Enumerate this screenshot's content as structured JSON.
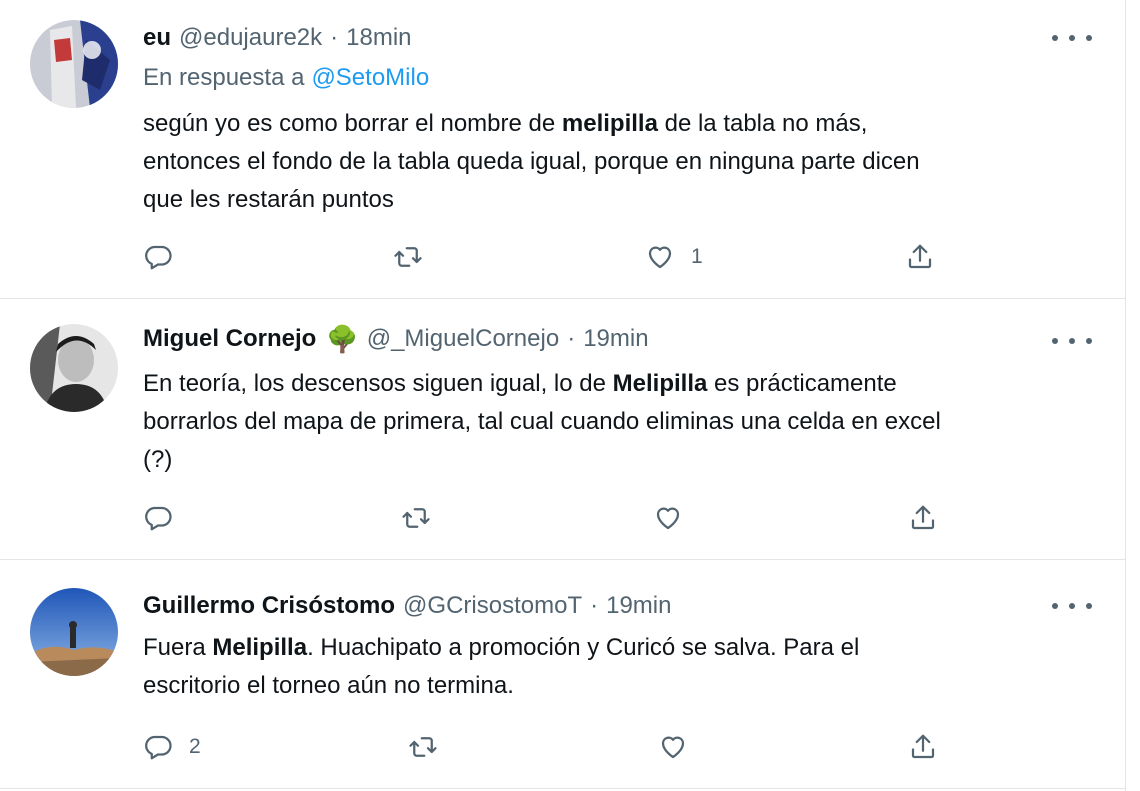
{
  "tweets": [
    {
      "name": "eu",
      "handle": "@edujaure2k",
      "time": "18min",
      "reply_prefix": "En respuesta a",
      "reply_mention": "@SetoMilo",
      "text_parts": [
        "según yo es como borrar el nombre de ",
        "melipilla",
        " de la tabla no más,",
        "entonces el fondo de la tabla queda igual, porque en ninguna parte dicen",
        "que les restarán puntos"
      ],
      "replies": "",
      "retweets": "",
      "likes": "1"
    },
    {
      "name": "Miguel Cornejo",
      "name_emoji": "🌳",
      "handle": "@_MiguelCornejo",
      "time": "19min",
      "text_parts": [
        "En teoría, los descensos siguen igual, lo de ",
        "Melipilla",
        " es prácticamente",
        "borrarlos del mapa de primera, tal cual cuando eliminas una celda en excel",
        "(?)"
      ],
      "replies": "",
      "retweets": "",
      "likes": ""
    },
    {
      "name": "Guillermo Crisóstomo",
      "handle": "@GCrisostomoT",
      "time": "19min",
      "text_parts": [
        "Fuera ",
        "Melipilla",
        ". Huachipato a promoción y Curicó se salva. Para el",
        "escritorio el torneo aún no termina."
      ],
      "replies": "2",
      "retweets": "",
      "likes": ""
    }
  ],
  "separator": "·",
  "icons": {
    "reply": "reply-icon",
    "retweet": "retweet-icon",
    "like": "heart-icon",
    "share": "share-icon",
    "more": "more-icon"
  },
  "colors": {
    "link": "#1d9bf0",
    "secondary": "#536471",
    "text": "#0f1419"
  }
}
